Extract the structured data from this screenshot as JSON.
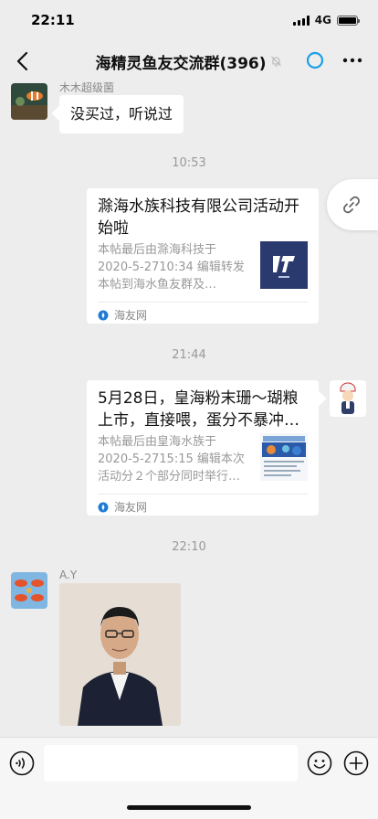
{
  "status_bar": {
    "time": "22:11",
    "network": "4G",
    "battery_level": 1.0
  },
  "nav": {
    "title": "海精灵鱼友交流群(396)",
    "back_icon": "chevron-left-icon",
    "mute_icon": "bell-off-icon",
    "mini_program_icon": "ring-icon",
    "more_icon": "ellipsis-icon"
  },
  "messages": {
    "msg1": {
      "sender": "木木超级菌",
      "text": "没买过，听说过"
    },
    "time1": "10:53",
    "card1": {
      "title": "滁海水族科技有限公司活动开始啦",
      "desc": "本帖最后由滁海科技于 2020-5-2710:34 编辑转发本帖到海水鱼友群及…",
      "source": "海友网"
    },
    "time2": "21:44",
    "card2": {
      "title": "5月28日，皇海粉末珊～瑚粮上市，直接喂，蛋分不暴冲…",
      "desc": "本帖最后由皇海水族于 2020-5-2715:15 编辑本次活动分２个部分同时举行…",
      "source": "海友网"
    },
    "time3": "22:10",
    "msg3": {
      "sender": "A.Y"
    }
  },
  "input_bar": {
    "placeholder": "",
    "voice_icon": "voice-icon",
    "emoji_icon": "emoji-icon",
    "plus_icon": "plus-icon"
  },
  "colors": {
    "background": "#ededed",
    "accent_blue": "#1aa0e8",
    "brand_navy": "#2a3a6e"
  }
}
